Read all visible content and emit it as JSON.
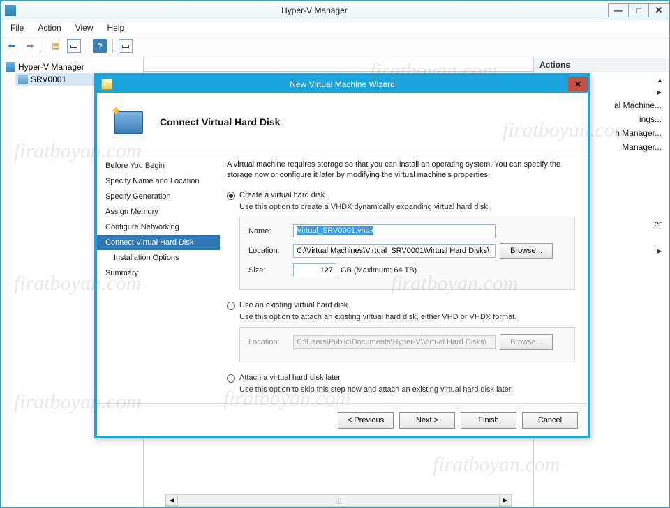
{
  "window": {
    "title": "Hyper-V Manager",
    "menus": {
      "file": "File",
      "action": "Action",
      "view": "View",
      "help": "Help"
    }
  },
  "tree": {
    "root": "Hyper-V Manager",
    "child": "SRV0001"
  },
  "actions": {
    "header": "Actions",
    "items": [
      "al Machine...",
      "ings...",
      "h Manager...",
      "Manager..."
    ],
    "extra": "er"
  },
  "wizard": {
    "title": "New Virtual Machine Wizard",
    "heading": "Connect Virtual Hard Disk",
    "nav": {
      "before": "Before You Begin",
      "nameloc": "Specify Name and Location",
      "gen": "Specify Generation",
      "mem": "Assign Memory",
      "net": "Configure Networking",
      "vhd": "Connect Virtual Hard Disk",
      "install": "Installation Options",
      "summary": "Summary"
    },
    "intro": "A virtual machine requires storage so that you can install an operating system. You can specify the storage now or configure it later by modifying the virtual machine's properties.",
    "opt1": {
      "label": "Create a virtual hard disk",
      "desc": "Use this option to create a VHDX dynamically expanding virtual hard disk.",
      "name_lbl": "Name:",
      "name_val": "Virtual_SRV0001.vhdx",
      "loc_lbl": "Location:",
      "loc_val": "C:\\Virtual Machines\\Virtual_SRV0001\\Virtual Hard Disks\\",
      "browse": "Browse...",
      "size_lbl": "Size:",
      "size_val": "127",
      "size_suffix": "GB (Maximum: 64 TB)"
    },
    "opt2": {
      "label": "Use an existing virtual hard disk",
      "desc": "Use this option to attach an existing virtual hard disk, either VHD or VHDX format.",
      "loc_lbl": "Location:",
      "loc_val": "C:\\Users\\Public\\Documents\\Hyper-V\\Virtual Hard Disks\\",
      "browse": "Browse..."
    },
    "opt3": {
      "label": "Attach a virtual hard disk later",
      "desc": "Use this option to skip this step now and attach an existing virtual hard disk later."
    },
    "buttons": {
      "prev": "< Previous",
      "next": "Next >",
      "finish": "Finish",
      "cancel": "Cancel"
    }
  },
  "watermark": "firatboyan.com"
}
